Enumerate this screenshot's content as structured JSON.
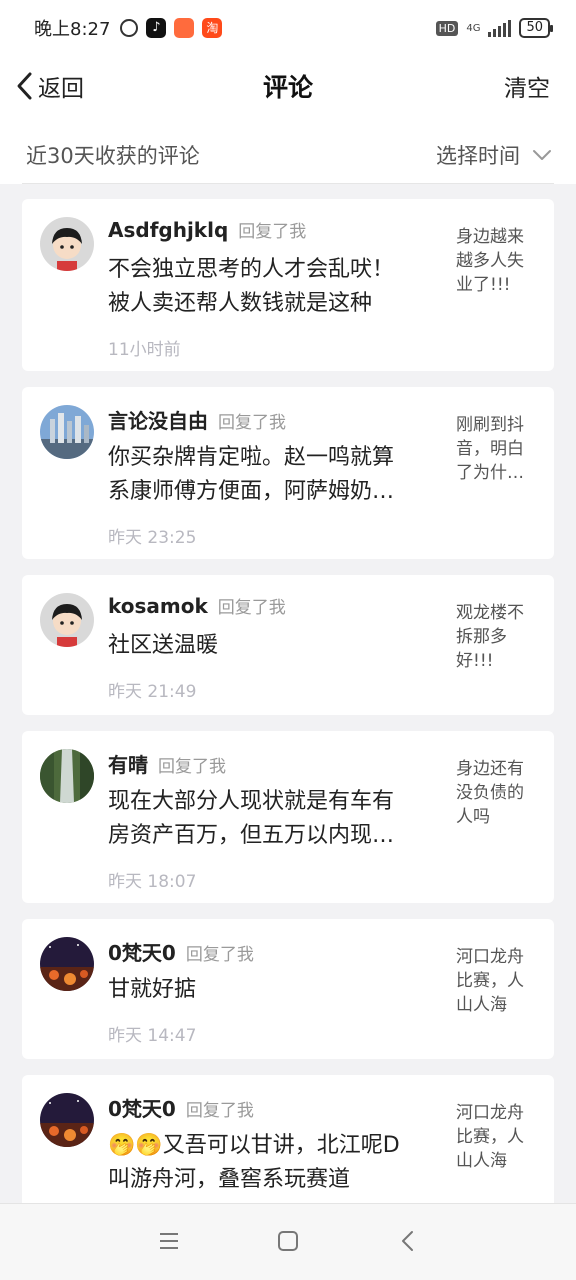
{
  "status": {
    "time": "晚上8:27",
    "hd": "HD",
    "network": "4G",
    "battery": "50"
  },
  "nav": {
    "back_label": "返回",
    "title": "评论",
    "clear_label": "清空"
  },
  "filter": {
    "label": "近30天收获的评论",
    "select_label": "选择时间"
  },
  "comments": [
    {
      "user": "Asdfghjklq",
      "action": "回复了我",
      "line1": "不会独立思考的人才会乱吠！",
      "line2": "被人卖还帮人数钱就是这种",
      "time": "11小时前",
      "original": "身边越来越多人失业了!!!"
    },
    {
      "user": "言论没自由",
      "action": "回复了我",
      "line1": "你买杂牌肯定啦。赵一鸣就算",
      "line2": "系康师傅方便面，阿萨姆奶…",
      "time": "昨天 23:25",
      "original": "刚刷到抖音，明白了为什…"
    },
    {
      "user": "kosamok",
      "action": "回复了我",
      "line1": "社区送温暖",
      "line2": "",
      "time": "昨天 21:49",
      "original": "观龙楼不拆那多好!!!"
    },
    {
      "user": "有晴",
      "action": "回复了我",
      "line1": "现在大部分人现状就是有车有",
      "line2": "房资产百万，但五万以内现…",
      "time": "昨天 18:07",
      "original": "身边还有没负债的人吗"
    },
    {
      "user": "0梵天0",
      "action": "回复了我",
      "line1": "甘就好掂",
      "line2": "",
      "time": "昨天 14:47",
      "original": "河口龙舟比赛，人山人海"
    },
    {
      "user": "0梵天0",
      "action": "回复了我",
      "line1": "🤭🤭又吾可以甘讲，北江呢D",
      "line2": "叫游舟河，叠窖系玩赛道",
      "time": "",
      "original": "河口龙舟比赛，人山人海"
    }
  ],
  "icons": {
    "back": "chevron-left-icon",
    "dropdown": "chevron-down-icon",
    "menu": "menu-icon",
    "home": "home-icon",
    "nav_back": "nav-back-icon"
  },
  "colors": {
    "background": "#f2f2f4",
    "card": "#ffffff",
    "muted": "#9a9a9a"
  }
}
